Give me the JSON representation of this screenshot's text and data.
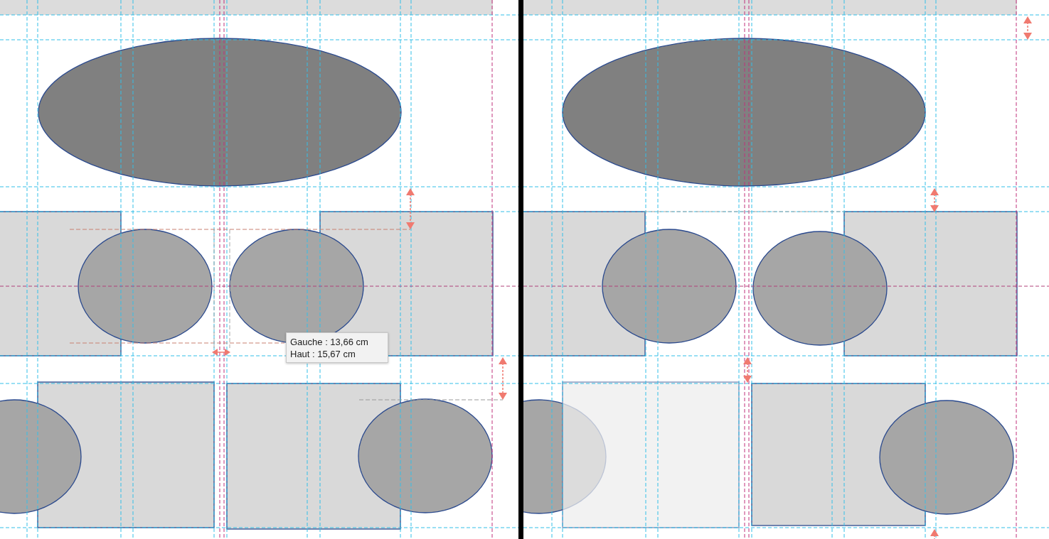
{
  "tooltip": {
    "lines": [
      "Gauche : 13,66 cm",
      "Haut : 15,67 cm"
    ]
  }
}
